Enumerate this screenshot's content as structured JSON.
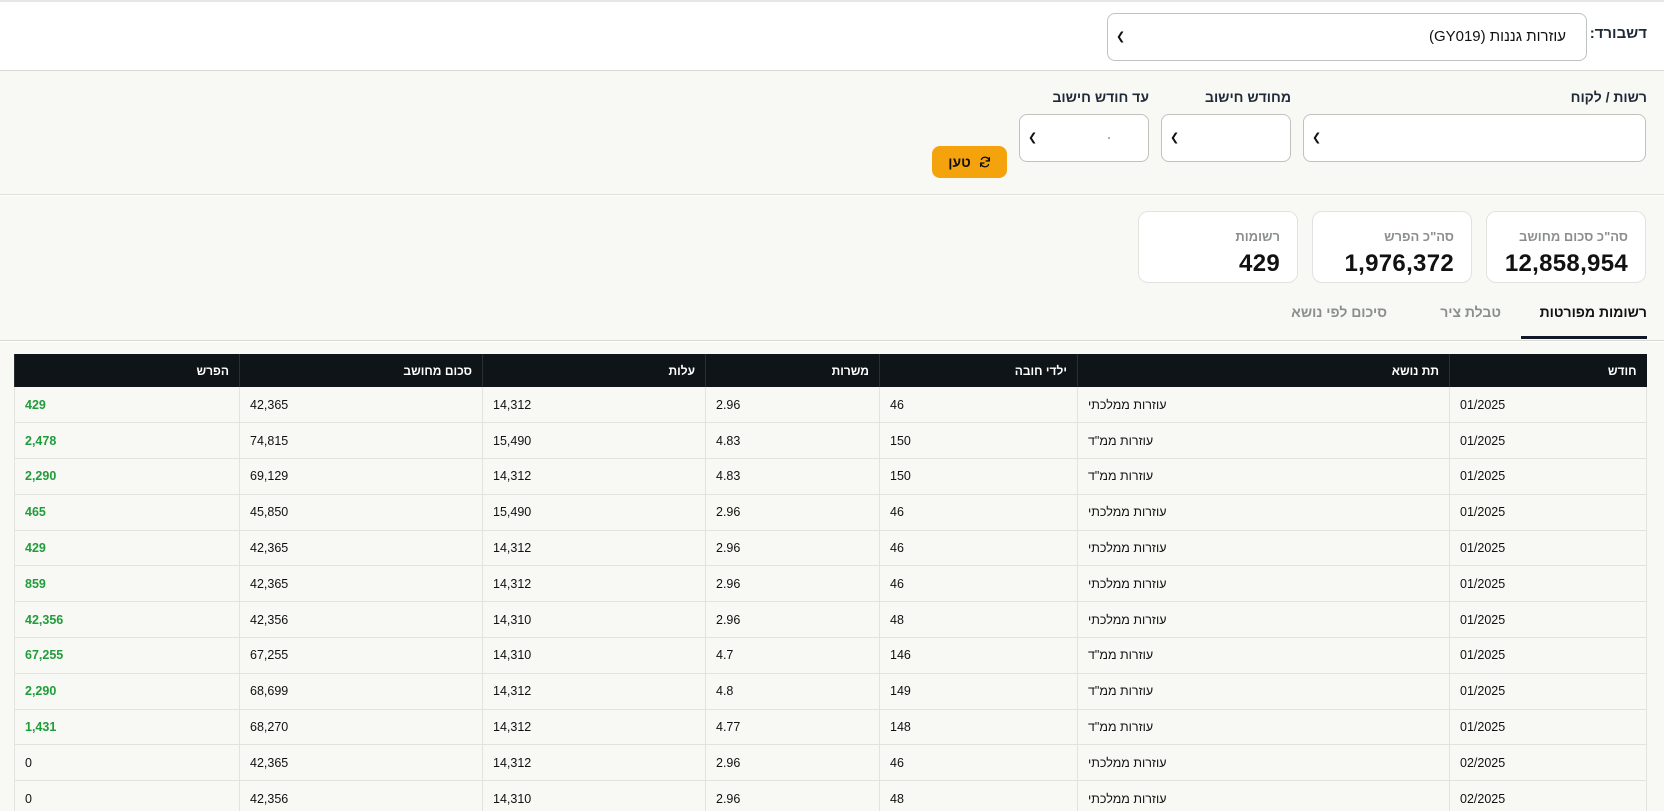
{
  "header": {
    "dashboard_label": "דשבורד:",
    "dashboard_value": "עוזרות גננות (GY019)"
  },
  "filters": {
    "authority_label": "רשות / לקוח",
    "from_month_label": "מחודש חישוב",
    "to_month_label": "עד חודש חישוב",
    "load_button": "טען"
  },
  "summary": {
    "cards": [
      {
        "label": "סה\"כ סכום מחושב",
        "value": "12,858,954"
      },
      {
        "label": "סה\"כ הפרש",
        "value": "1,976,372"
      },
      {
        "label": "רשומות",
        "value": "429"
      }
    ]
  },
  "tabs": [
    {
      "label": "רשומות מפורטות",
      "active": true
    },
    {
      "label": "טבלת ציר",
      "active": false
    },
    {
      "label": "סיכום לפי נושא",
      "active": false
    }
  ],
  "table": {
    "columns": [
      "חודש",
      "תת נושא",
      "ילדי חובה",
      "משרות",
      "עלות",
      "סכום מחושב",
      "הפרש"
    ],
    "rows": [
      [
        "01/2025",
        "עוזרות ממלכתי",
        "46",
        "2.96",
        "14,312",
        "42,365",
        "429"
      ],
      [
        "01/2025",
        "עוזרות ממ\"ד",
        "150",
        "4.83",
        "15,490",
        "74,815",
        "2,478"
      ],
      [
        "01/2025",
        "עוזרות ממ\"ד",
        "150",
        "4.83",
        "14,312",
        "69,129",
        "2,290"
      ],
      [
        "01/2025",
        "עוזרות ממלכתי",
        "46",
        "2.96",
        "15,490",
        "45,850",
        "465"
      ],
      [
        "01/2025",
        "עוזרות ממלכתי",
        "46",
        "2.96",
        "14,312",
        "42,365",
        "429"
      ],
      [
        "01/2025",
        "עוזרות ממלכתי",
        "46",
        "2.96",
        "14,312",
        "42,365",
        "859"
      ],
      [
        "01/2025",
        "עוזרות ממלכתי",
        "48",
        "2.96",
        "14,310",
        "42,356",
        "42,356"
      ],
      [
        "01/2025",
        "עוזרות ממ\"ד",
        "146",
        "4.7",
        "14,310",
        "67,255",
        "67,255"
      ],
      [
        "01/2025",
        "עוזרות ממ\"ד",
        "149",
        "4.8",
        "14,312",
        "68,699",
        "2,290"
      ],
      [
        "01/2025",
        "עוזרות ממ\"ד",
        "148",
        "4.77",
        "14,312",
        "68,270",
        "1,431"
      ],
      [
        "02/2025",
        "עוזרות ממלכתי",
        "46",
        "2.96",
        "14,312",
        "42,365",
        "0"
      ],
      [
        "02/2025",
        "עוזרות ממלכתי",
        "48",
        "2.96",
        "14,310",
        "42,356",
        "0"
      ]
    ]
  },
  "colors": {
    "accent": "#f5a30c",
    "positive": "#1f9d3a",
    "table_header": "#0f1419"
  }
}
